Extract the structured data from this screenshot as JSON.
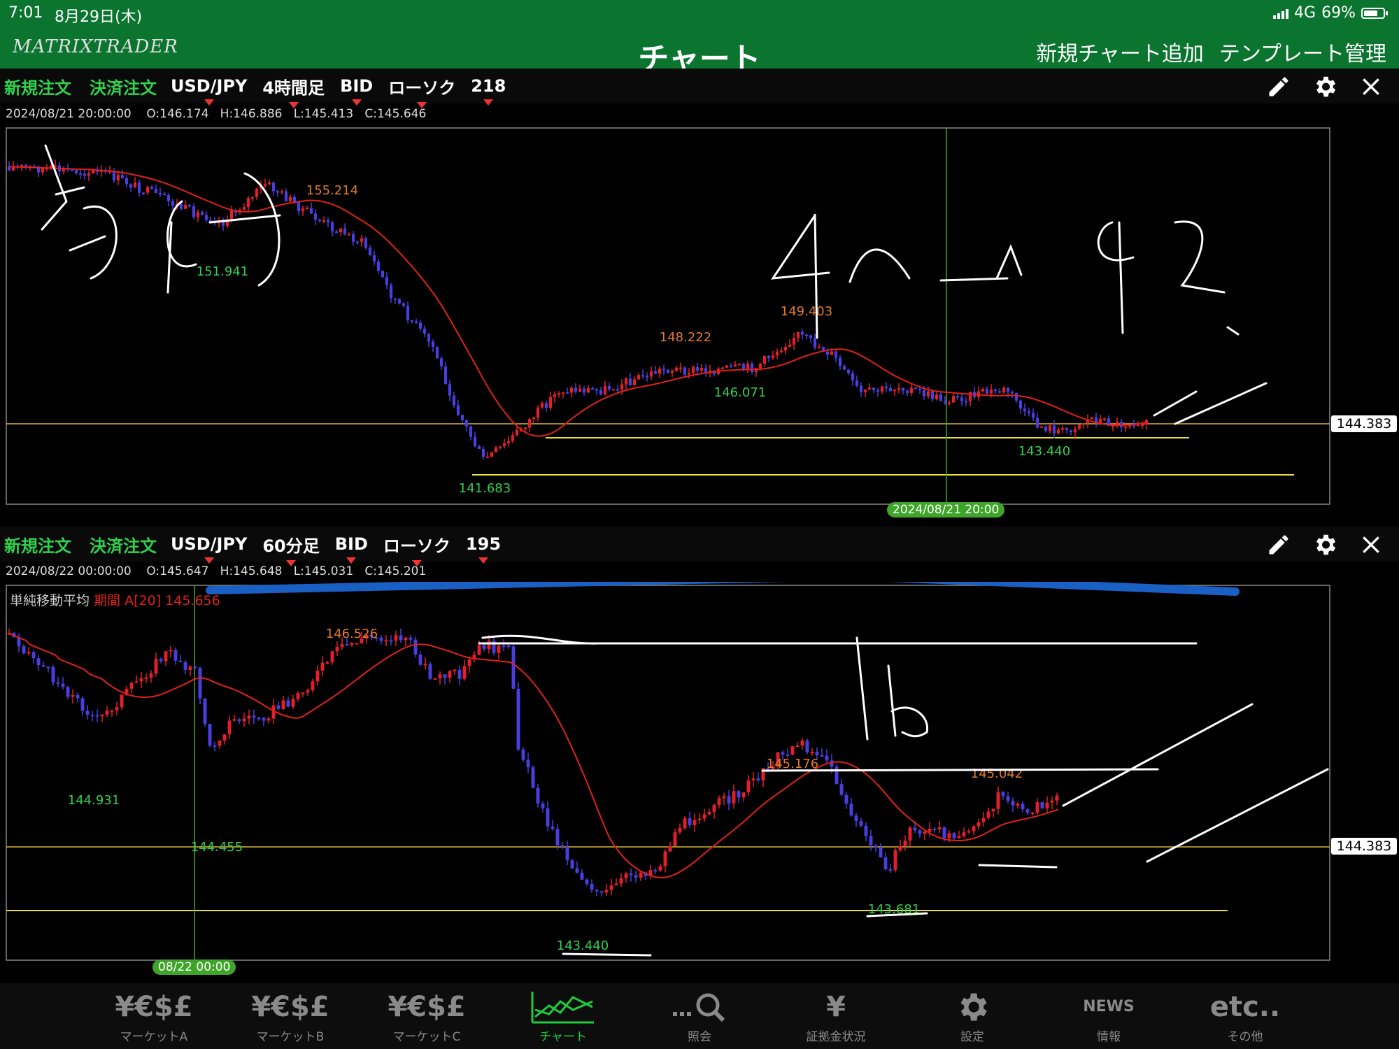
{
  "status": {
    "time": "7:01",
    "date": "8月29日(木)",
    "network": "4G",
    "battery": "69%"
  },
  "nav": {
    "logo": "MATRIXTRADER",
    "title": "チャート",
    "add_chart": "新規チャート追加",
    "template": "テンプレート管理"
  },
  "panels": [
    {
      "new_order": "新規注文",
      "close_order": "決済注文",
      "pair": "USD/JPY",
      "timeframe": "4時間足",
      "price_type": "BID",
      "chart_type": "ローソク",
      "bars": "218",
      "ohlc": "2024/08/21 20:00:00    O:146.174   H:146.886   L:145.413   C:145.646",
      "price_badge": "144.383",
      "time_badge": "2024/08/21 20:00",
      "labels": {
        "high1": "155.214",
        "low1": "151.941",
        "high2": "148.222",
        "high3": "149.403",
        "low2": "146.071",
        "low3": "141.683",
        "low4": "143.440"
      }
    },
    {
      "new_order": "新規注文",
      "close_order": "決済注文",
      "pair": "USD/JPY",
      "timeframe": "60分足",
      "price_type": "BID",
      "chart_type": "ローソク",
      "bars": "195",
      "ohlc": "2024/08/22 00:00:00    O:145.647   H:145.648   L:145.031   C:145.201",
      "indicator_name": "単純移動平均",
      "indicator_param": "期間 A[20] 145.656",
      "price_badge": "144.383",
      "time_badge": "08/22 00:00",
      "labels": {
        "high1": "146.526",
        "low1": "144.931",
        "cross": "144.455",
        "high2": "145.176",
        "high3": "145.042",
        "low2": "143.440",
        "low3": "143.681"
      }
    }
  ],
  "tabs": [
    {
      "label": "マーケットA",
      "icon": "¥€$£"
    },
    {
      "label": "マーケットB",
      "icon": "¥€$£"
    },
    {
      "label": "マーケットC",
      "icon": "¥€$£"
    },
    {
      "label": "チャート",
      "icon": "chart-icon"
    },
    {
      "label": "照会",
      "icon": "search-icon"
    },
    {
      "label": "証拠金状況",
      "icon": "¥"
    },
    {
      "label": "設定",
      "icon": "gear-icon"
    },
    {
      "label": "情報",
      "icon": "NEWS"
    },
    {
      "label": "その他",
      "icon": "etc.."
    }
  ],
  "colors": {
    "green": "#0b7530",
    "order": "#2fd24e",
    "sma": "#e0201c",
    "bull": "#e0202a",
    "bear": "#4a3ee0",
    "hline": "#d9b43a"
  },
  "chart_data": [
    {
      "type": "candlestick",
      "pair": "USD/JPY",
      "timeframe": "4時間足",
      "labels": [
        "155.214",
        "151.941",
        "148.222",
        "149.403",
        "146.071",
        "141.683",
        "143.440"
      ],
      "current": 144.383
    },
    {
      "type": "candlestick",
      "pair": "USD/JPY",
      "timeframe": "60分足",
      "labels": [
        "146.526",
        "144.931",
        "144.455",
        "145.176",
        "145.042",
        "143.440",
        "143.681"
      ],
      "current": 144.383
    }
  ]
}
